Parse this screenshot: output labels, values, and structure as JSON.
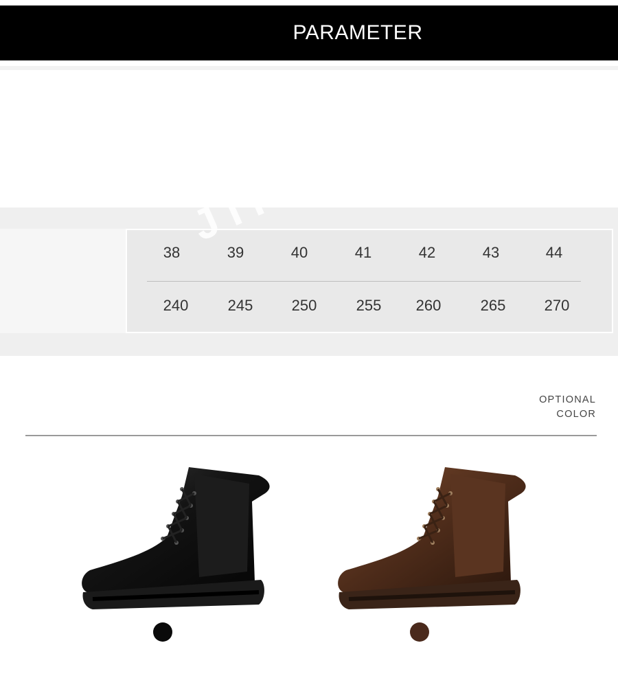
{
  "header": {
    "title": "PARAMETER"
  },
  "size_chart": {
    "eu_sizes": [
      "38",
      "39",
      "40",
      "41",
      "42",
      "43",
      "44"
    ],
    "lengths_mm": [
      "240",
      "245",
      "250",
      "255",
      "260",
      "265",
      "270"
    ]
  },
  "watermark": "JIKTEM",
  "optional_color": {
    "line1": "OPTIONAL",
    "line2": "COLOR"
  },
  "products": [
    {
      "name": "black-boot",
      "swatch_color": "#0a0a0a"
    },
    {
      "name": "brown-boot",
      "swatch_color": "#4a2a1c"
    }
  ]
}
